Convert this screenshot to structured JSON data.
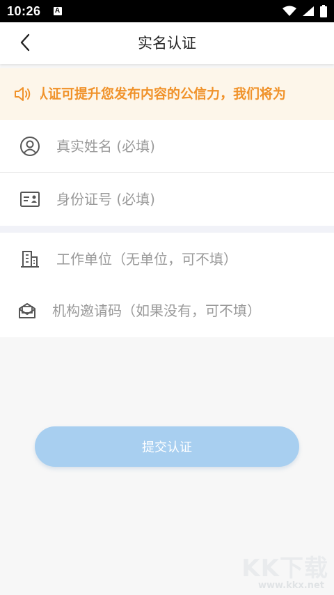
{
  "status_bar": {
    "time": "10:26",
    "a_icon": "A",
    "icons": [
      "wifi-icon",
      "signal-icon",
      "battery-icon"
    ]
  },
  "header": {
    "title": "实名认证",
    "back_icon": "chevron-left-icon"
  },
  "notice": {
    "icon": "speaker-icon",
    "text": "认证可提升您发布内容的公信力，我们将为",
    "color": "#f0922a",
    "background": "#fdf6ea"
  },
  "form": {
    "section1": [
      {
        "icon": "user-icon",
        "placeholder": "真实姓名 (必填)",
        "value": ""
      },
      {
        "icon": "id-card-icon",
        "placeholder": "身份证号 (必填)",
        "value": ""
      }
    ],
    "section2": [
      {
        "icon": "building-icon",
        "placeholder": "工作单位（无单位，可不填）",
        "value": ""
      },
      {
        "icon": "envelope-icon",
        "placeholder": "机构邀请码（如果没有，可不填）",
        "value": ""
      }
    ]
  },
  "submit": {
    "label": "提交认证",
    "color": "#a8cff0"
  },
  "watermark": {
    "logo": "KK下载",
    "url": "www.kkx.net"
  }
}
